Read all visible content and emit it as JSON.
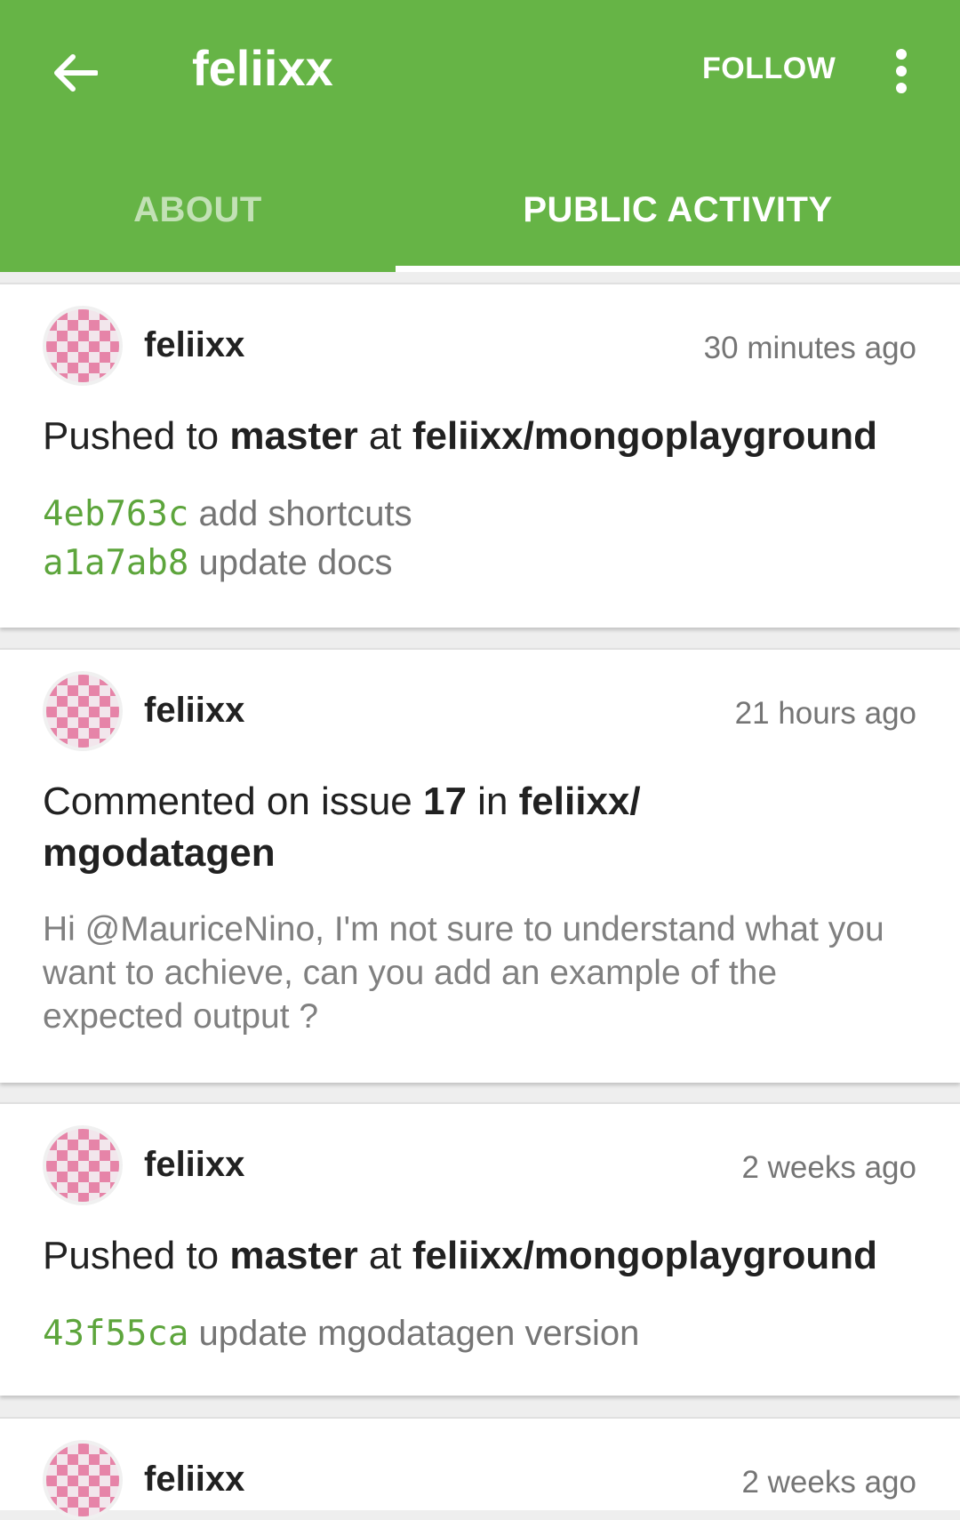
{
  "appbar": {
    "back_icon": "arrow-back-icon",
    "title": "feliixx",
    "follow_label": "FOLLOW",
    "more_icon": "more-vertical-icon",
    "color": "#66b446"
  },
  "tabs": [
    {
      "label": "ABOUT",
      "selected": false
    },
    {
      "label": "PUBLIC ACTIVITY",
      "selected": true
    }
  ],
  "feed": [
    {
      "user": "feliixx",
      "time": "30 minutes ago",
      "event": {
        "verb": "Pushed to ",
        "ref": "master",
        "mid": " at ",
        "repo": "feliixx/mongoplayground"
      },
      "commits": [
        {
          "sha": "4eb763c",
          "message": "add shortcuts"
        },
        {
          "sha": "a1a7ab8",
          "message": "update docs"
        }
      ]
    },
    {
      "user": "feliixx",
      "time": "21 hours ago",
      "event": {
        "verb": "Commented on issue ",
        "ref": "17",
        "mid": " in ",
        "repo": "feliixx/",
        "repo2": "mgodatagen"
      },
      "comment": "Hi @MauriceNino, I'm not sure to understand what you want to achieve, can you add an example of the expected output ?"
    },
    {
      "user": "feliixx",
      "time": "2 weeks ago",
      "event": {
        "verb": "Pushed to ",
        "ref": "master",
        "mid": " at ",
        "repo": "feliixx/mongoplayground"
      },
      "commits": [
        {
          "sha": "43f55ca",
          "message": "update mgodatagen version"
        }
      ]
    },
    {
      "user": "feliixx",
      "time": "2 weeks ago"
    }
  ]
}
